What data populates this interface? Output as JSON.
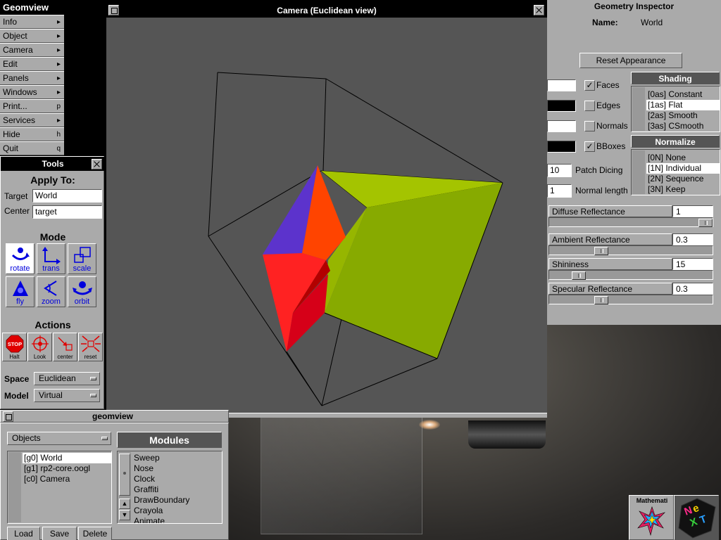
{
  "menu": {
    "title": "Geomview",
    "items": [
      {
        "label": "Info",
        "key": "▸"
      },
      {
        "label": "Object",
        "key": "▸"
      },
      {
        "label": "Camera",
        "key": "▸"
      },
      {
        "label": "Edit",
        "key": "▸"
      },
      {
        "label": "Panels",
        "key": "▸"
      },
      {
        "label": "Windows",
        "key": "▸"
      },
      {
        "label": "Print...",
        "key": "p"
      },
      {
        "label": "Services",
        "key": "▸"
      },
      {
        "label": "Hide",
        "key": "h"
      },
      {
        "label": "Quit",
        "key": "q"
      }
    ]
  },
  "tools": {
    "title": "Tools",
    "apply_to": "Apply To:",
    "target_label": "Target",
    "target_value": "World",
    "center_label": "Center",
    "center_value": "target",
    "mode_heading": "Mode",
    "modes": [
      {
        "label": "rotate",
        "icon": "rotate-icon",
        "active": true
      },
      {
        "label": "trans",
        "icon": "translate-icon",
        "active": false
      },
      {
        "label": "scale",
        "icon": "scale-icon",
        "active": false
      },
      {
        "label": "fly",
        "icon": "fly-icon",
        "active": false
      },
      {
        "label": "zoom",
        "icon": "zoom-icon",
        "active": false
      },
      {
        "label": "orbit",
        "icon": "orbit-icon",
        "active": false
      }
    ],
    "actions_heading": "Actions",
    "actions": [
      {
        "label": "Halt",
        "icon": "stop-icon",
        "glyph": "STOP"
      },
      {
        "label": "Look",
        "icon": "look-icon"
      },
      {
        "label": "center",
        "icon": "center-icon"
      },
      {
        "label": "reset",
        "icon": "reset-icon"
      }
    ],
    "space_label": "Space",
    "space_value": "Euclidean",
    "model_label": "Model",
    "model_value": "Virtual"
  },
  "camera": {
    "title": "Camera (Euclidean view)"
  },
  "inspector": {
    "title": "Geometry Inspector",
    "name_label": "Name:",
    "name_value": "World",
    "reset_button": "Reset Appearance",
    "checks": [
      {
        "label": "Faces",
        "checked": true,
        "mark": "✓"
      },
      {
        "label": "Edges",
        "checked": false,
        "mark": ""
      },
      {
        "label": "Normals",
        "checked": false,
        "mark": ""
      },
      {
        "label": "BBoxes",
        "checked": true,
        "mark": "✓"
      }
    ],
    "swatch_colors": [
      "#ffffff",
      "#000000",
      "#ffffff",
      "#000000"
    ],
    "patch_dicing_value": "10",
    "patch_dicing_label": "Patch Dicing",
    "normal_length_value": "1",
    "normal_length_label": "Normal length",
    "shading": {
      "heading": "Shading",
      "items": [
        "[0as] Constant",
        "[1as] Flat",
        "[2as] Smooth",
        "[3as] CSmooth"
      ],
      "selected": 1
    },
    "normalize": {
      "heading": "Normalize",
      "items": [
        "[0N] None",
        "[1N] Individual",
        "[2N] Sequence",
        "[3N] Keep"
      ],
      "selected": 1
    },
    "sliders": [
      {
        "label": "Diffuse Reflectance",
        "value": "1",
        "level": 1.0
      },
      {
        "label": "Ambient Reflectance",
        "value": "0.3",
        "level": 0.3
      },
      {
        "label": "Shininess",
        "value": "15",
        "level": 0.15
      },
      {
        "label": "Specular Reflectance",
        "value": "0.3",
        "level": 0.3
      }
    ]
  },
  "geomview": {
    "title": "geomview",
    "objects_popup": "Objects",
    "objects": [
      "[g0] World",
      "[g1] rp2-core.oogl",
      "[c0] Camera"
    ],
    "selected_object": 0,
    "modules_heading": "Modules",
    "modules": [
      "Sweep",
      "Nose",
      "Clock",
      "Graffiti",
      "DrawBoundary",
      "Crayola",
      "Animate"
    ],
    "buttons": [
      "Load",
      "Save",
      "Delete"
    ]
  },
  "dock": {
    "mathematica_label": "Mathemati",
    "next_label": "NeXT"
  }
}
